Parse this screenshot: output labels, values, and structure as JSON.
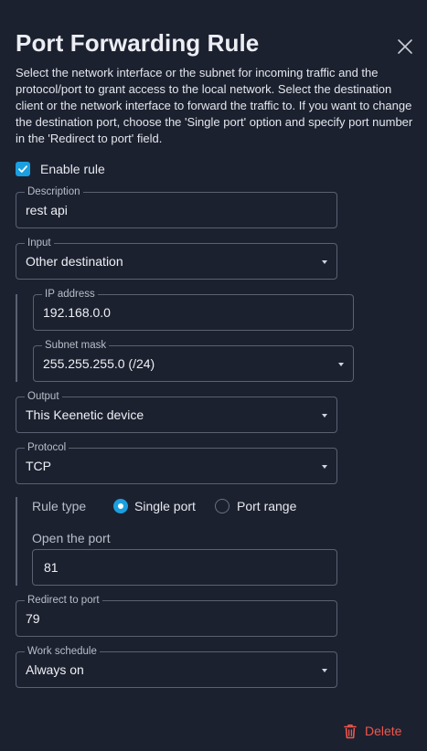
{
  "dialog": {
    "title": "Port Forwarding Rule",
    "description": "Select the network interface or the subnet for incoming traffic and the protocol/port to grant access to the local network. Select the destination client or the network interface to forward the traffic to. If you want to change the destination port, choose the 'Single port' option and specify port number in the 'Redirect to port' field."
  },
  "enable_rule": {
    "label": "Enable rule",
    "checked": true
  },
  "fields": {
    "description": {
      "label": "Description",
      "value": "rest api"
    },
    "input": {
      "label": "Input",
      "value": "Other destination"
    },
    "ip_address": {
      "label": "IP address",
      "value": "192.168.0.0"
    },
    "subnet_mask": {
      "label": "Subnet mask",
      "value": "255.255.255.0 (/24)"
    },
    "output": {
      "label": "Output",
      "value": "This Keenetic device"
    },
    "protocol": {
      "label": "Protocol",
      "value": "TCP"
    },
    "open_port": {
      "label": "Open the port",
      "value": "81"
    },
    "redirect_port": {
      "label": "Redirect to port",
      "value": "79"
    },
    "work_schedule": {
      "label": "Work schedule",
      "value": "Always on"
    }
  },
  "rule_type": {
    "label": "Rule type",
    "options": [
      "Single port",
      "Port range"
    ],
    "selected": "Single port"
  },
  "actions": {
    "delete_label": "Delete"
  },
  "colors": {
    "background": "#1c2130",
    "accent": "#1a9fe0",
    "danger": "#f0564a",
    "border": "#5b6171"
  },
  "icons": {
    "close": "close-icon",
    "checkbox": "checkmark-icon",
    "delete": "trash-icon",
    "dropdown": "caret-down-icon"
  }
}
